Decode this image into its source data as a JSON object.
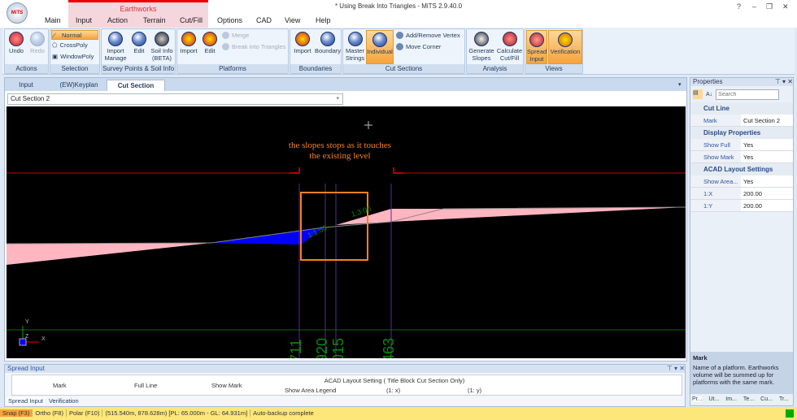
{
  "window": {
    "title": "* Using Break Into Triangles - MiTS 2.9.40.0",
    "logo": "MiTS",
    "help": "?",
    "minimize": "–",
    "restore": "❐",
    "close": "✕"
  },
  "context_tab": "Earthworks",
  "tabs": [
    "Main",
    "Input",
    "Action",
    "Terrain",
    "Cut/Fill",
    "Options",
    "CAD",
    "View",
    "Help"
  ],
  "ribbon": {
    "actions": {
      "label": "Actions",
      "undo": "Undo",
      "redo": "Redo"
    },
    "selection": {
      "label": "Selection",
      "normal": "Normal",
      "crosspoly": "CrossPoly",
      "windowpoly": "WindowPoly"
    },
    "survey": {
      "label": "Survey Points & Soil Info",
      "import": "Import Manage",
      "edit": "Edit",
      "soil": "Soil Info (BETA)"
    },
    "platforms": {
      "label": "Platforms",
      "import": "Import",
      "edit": "Edit",
      "merge": "Merge",
      "break": "Break into Triangles"
    },
    "boundaries": {
      "label": "Boundaries",
      "import": "Import",
      "boundary": "Boundary"
    },
    "cut_sections": {
      "label": "Cut Sections",
      "master": "Master Strings",
      "individual": "Individual",
      "add_remove": "Add/Remove Vertex",
      "move_corner": "Move Corner"
    },
    "analysis": {
      "label": "Analysis",
      "generate": "Generate Slopes",
      "calculate": "Calculate Cut/Fill"
    },
    "views": {
      "label": "Views",
      "spread": "Spread Input",
      "verification": "Verification"
    }
  },
  "doc_tabs": [
    "Input",
    "(EW)Keyplan",
    "Cut Section"
  ],
  "section_select": "Cut Section 2",
  "cad": {
    "annotation_line1": "the slopes stops as it touches",
    "annotation_line2": "the existing level",
    "slope_left": "1:1.50",
    "slope_right": "1:3.00",
    "chainages": [
      "711",
      "920",
      "015",
      "463"
    ],
    "axis_x": "X",
    "axis_y": "Y",
    "axis_z": "Z"
  },
  "properties": {
    "title": "Properties",
    "search_placeholder": "Search",
    "cat1": "Cut Line",
    "mark_k": "Mark",
    "mark_v": "Cut Section 2",
    "cat2": "Display Properties",
    "showfull_k": "Show Full",
    "showfull_v": "Yes",
    "showmark_k": "Show Mark",
    "showmark_v": "Yes",
    "cat3": "ACAD Layout Settings",
    "showarea_k": "Show Area...",
    "showarea_v": "Yes",
    "x_k": "1:X",
    "x_v": "200.00",
    "y_k": "1:Y",
    "y_v": "200.00",
    "help_title": "Mark",
    "help_text": "Name of a platform. Earthworks volume will be summed up for platforms with the same mark.",
    "bottom_tabs": [
      "Pr...",
      "Ut...",
      "Im...",
      "Te...",
      "Cu...",
      "Tr..."
    ]
  },
  "spread": {
    "title": "Spread Input",
    "cols": [
      "Mark",
      "Full Line",
      "Show Mark"
    ],
    "group": "ACAD Layout Setting ( Title Block Cut Section Only)",
    "sub": [
      "Show Area Legend",
      "(1: x)",
      "(1: y)"
    ],
    "tabs": [
      "Spread Input",
      "Verification"
    ]
  },
  "status": {
    "snap": "Snap (F3)",
    "ortho": "Ortho (F8)",
    "polar": "Polar (F10)",
    "coords": "(515.540m, 878.628m) [PL: 65.000m - GL: 64.931m]",
    "message": "Auto-backup complete"
  },
  "colors": {
    "accent": "#f7a33b",
    "fill": "#ffb6c1",
    "cut": "#0000ff",
    "box": "#f58220"
  }
}
